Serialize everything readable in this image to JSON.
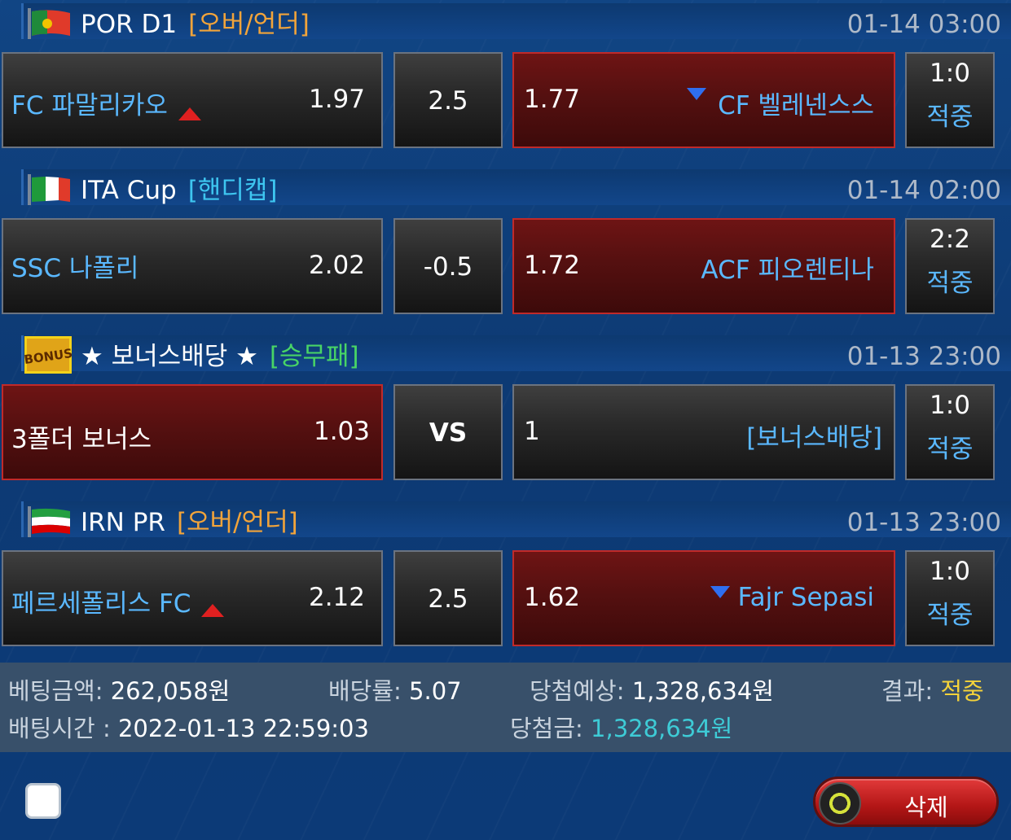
{
  "matches": [
    {
      "league": "POR D1",
      "bet_type": "[오버/언더]",
      "time": "01-14 03:00",
      "home": {
        "name": "FC 파말리카오",
        "odd": "1.97",
        "arrow": "up"
      },
      "mid": "2.5",
      "away": {
        "odd": "1.77",
        "name": "CF 벨레넨스스",
        "arrow": "down"
      },
      "score": "1:0",
      "result": "적중",
      "selected": "away"
    },
    {
      "league": "ITA Cup",
      "bet_type": "[핸디캡]",
      "time": "01-14 02:00",
      "home": {
        "name": "SSC 나폴리",
        "odd": "2.02"
      },
      "mid": "-0.5",
      "away": {
        "odd": "1.72",
        "name": "ACF 피오렌티나"
      },
      "score": "2:2",
      "result": "적중",
      "selected": "away"
    },
    {
      "league": "★ 보너스배당 ★",
      "bet_type": "[승무패]",
      "badge": "BONUS",
      "time": "01-13 23:00",
      "home": {
        "name": "3폴더 보너스",
        "odd": "1.03"
      },
      "mid": "VS",
      "away": {
        "odd": "1",
        "name": "[보너스배당]"
      },
      "score": "1:0",
      "result": "적중",
      "selected": "home"
    },
    {
      "league": "IRN PR",
      "bet_type": "[오버/언더]",
      "time": "01-13 23:00",
      "home": {
        "name": "페르세폴리스 FC",
        "odd": "2.12",
        "arrow": "up"
      },
      "mid": "2.5",
      "away": {
        "odd": "1.62",
        "name": "Fajr Sepasi",
        "arrow": "down"
      },
      "score": "1:0",
      "result": "적중",
      "selected": "away"
    }
  ],
  "summary": {
    "bet_amount_label": "베팅금액:",
    "bet_amount": "262,058원",
    "odds_label": "배당률:",
    "odds": "5.07",
    "expected_label": "당첨예상:",
    "expected": "1,328,634원",
    "result_label": "결과:",
    "result": "적중",
    "bet_time_label": "배팅시간 :",
    "bet_time": "2022-01-13 22:59:03",
    "win_label": "당첨금:",
    "win": "1,328,634원"
  },
  "actions": {
    "delete_label": "삭제"
  },
  "colors": {
    "selected_bg": "#551010",
    "team_blue": "#5ab8ff",
    "over_under": "#f2a43a",
    "handicap": "#3ec6f0",
    "win_draw_lose": "#48d466",
    "result_yellow": "#f4d23a",
    "win_cyan": "#3ecbd6"
  }
}
